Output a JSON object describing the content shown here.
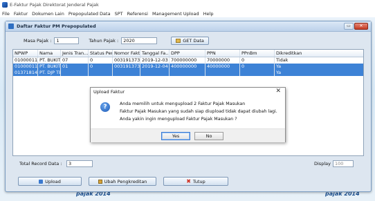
{
  "app": {
    "title": "E-Faktur Pajak Direktorat Jenderal Pajak",
    "menu": [
      "File",
      "Faktur",
      "Dokumen Lain",
      "Prepopulated Data",
      "SPT",
      "Referensi",
      "Management Upload",
      "Help"
    ]
  },
  "window": {
    "title": "Daftar Faktur PM Prepopulated",
    "controls": {
      "restore": "▭",
      "close": "✕"
    }
  },
  "filters": {
    "masa_label": "Masa Pajak :",
    "masa_value": "1",
    "tahun_label": "Tahun Pajak :",
    "tahun_value": "2020",
    "get_label": "GET Data"
  },
  "table": {
    "columns": [
      "NPWP",
      "Nama",
      "Jenis Tran...",
      "Status Pen...",
      "Nomor Faktur",
      "Tanggal Fa...",
      "DPP",
      "PPN",
      "PPnBm",
      "Dikreditkan"
    ],
    "rows": [
      [
        "0100001150...",
        "PT. BUKIT AS...",
        "07",
        "0",
        "0031913737...",
        "2019-12-03",
        "700000000",
        "70000000",
        "0",
        "Tidak"
      ],
      [
        "0100001150...",
        "PT. BUKIT AS...",
        "01",
        "0",
        "0031913737...",
        "2019-12-04",
        "400000000",
        "40000000",
        "0",
        "Ya"
      ],
      [
        "0137181430...",
        "PT. DJP TEK",
        "",
        "",
        "",
        "",
        "",
        "",
        "",
        "Ya"
      ]
    ],
    "selected_rows": [
      1,
      2
    ]
  },
  "footer": {
    "total_label": "Total Record Data :",
    "total_value": "3",
    "display_label": "Display",
    "display_value": "100"
  },
  "actions": {
    "upload": "Upload",
    "ubah": "Ubah Pengkreditan",
    "tutup": "Tutup"
  },
  "dialog": {
    "title": "Upload Faktur",
    "close": "✕",
    "icon": "?",
    "line1": "Anda memilih untuk mengupload 2 Faktur Pajak Masukan",
    "line2": "Faktur Pajak Masukan yang sudah siap diupload tidak dapat diubah lagi.",
    "line3": "Anda yakin ingin mengupload Faktur Pajak Masukan ?",
    "yes": "Yes",
    "no": "No"
  },
  "watermark": {
    "left": "pajak 2014",
    "right": "pajak 2014"
  }
}
